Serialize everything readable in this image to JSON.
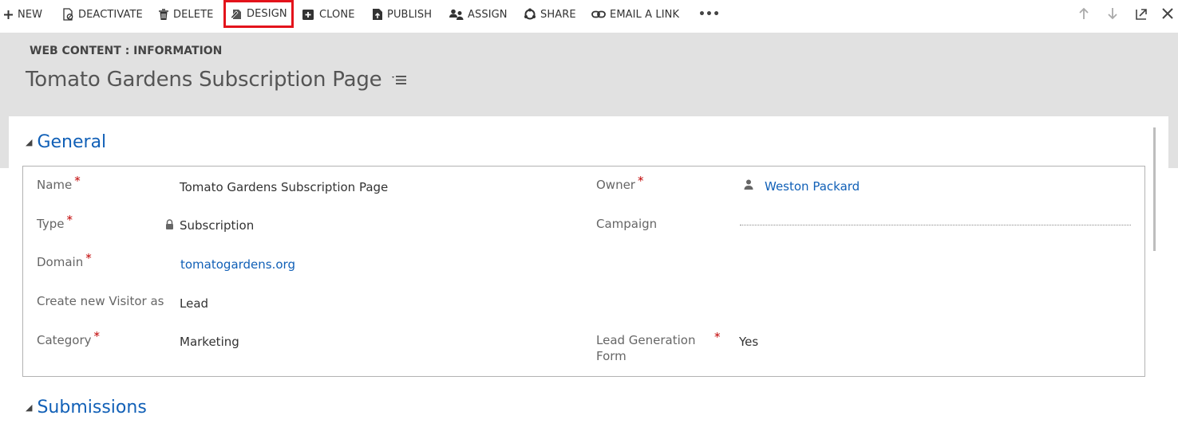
{
  "toolbar": {
    "new": "NEW",
    "deactivate": "DEACTIVATE",
    "delete": "DELETE",
    "design": "DESIGN",
    "clone": "CLONE",
    "publish": "PUBLISH",
    "assign": "ASSIGN",
    "share": "SHARE",
    "email_link": "EMAIL A LINK",
    "more": "•••"
  },
  "header": {
    "entity": "WEB CONTENT : INFORMATION",
    "title": "Tomato Gardens Subscription Page"
  },
  "sections": {
    "general": "General",
    "submissions": "Submissions"
  },
  "fields": {
    "name_label": "Name",
    "name_value": "Tomato Gardens Subscription Page",
    "type_label": "Type",
    "type_value": "Subscription",
    "domain_label": "Domain",
    "domain_value": "tomatogardens.org",
    "visitor_label": "Create new Visitor as",
    "visitor_value": "Lead",
    "category_label": "Category",
    "category_value": "Marketing",
    "owner_label": "Owner",
    "owner_value": "Weston Packard",
    "campaign_label": "Campaign",
    "leadgen_label_1": "Lead Generation",
    "leadgen_label_2": "Form",
    "leadgen_value": "Yes",
    "required_mark": "*"
  },
  "colors": {
    "accent": "#1160b7",
    "header_bg": "#e1e1e1",
    "highlight": "#e3131b",
    "required": "#c00000"
  }
}
